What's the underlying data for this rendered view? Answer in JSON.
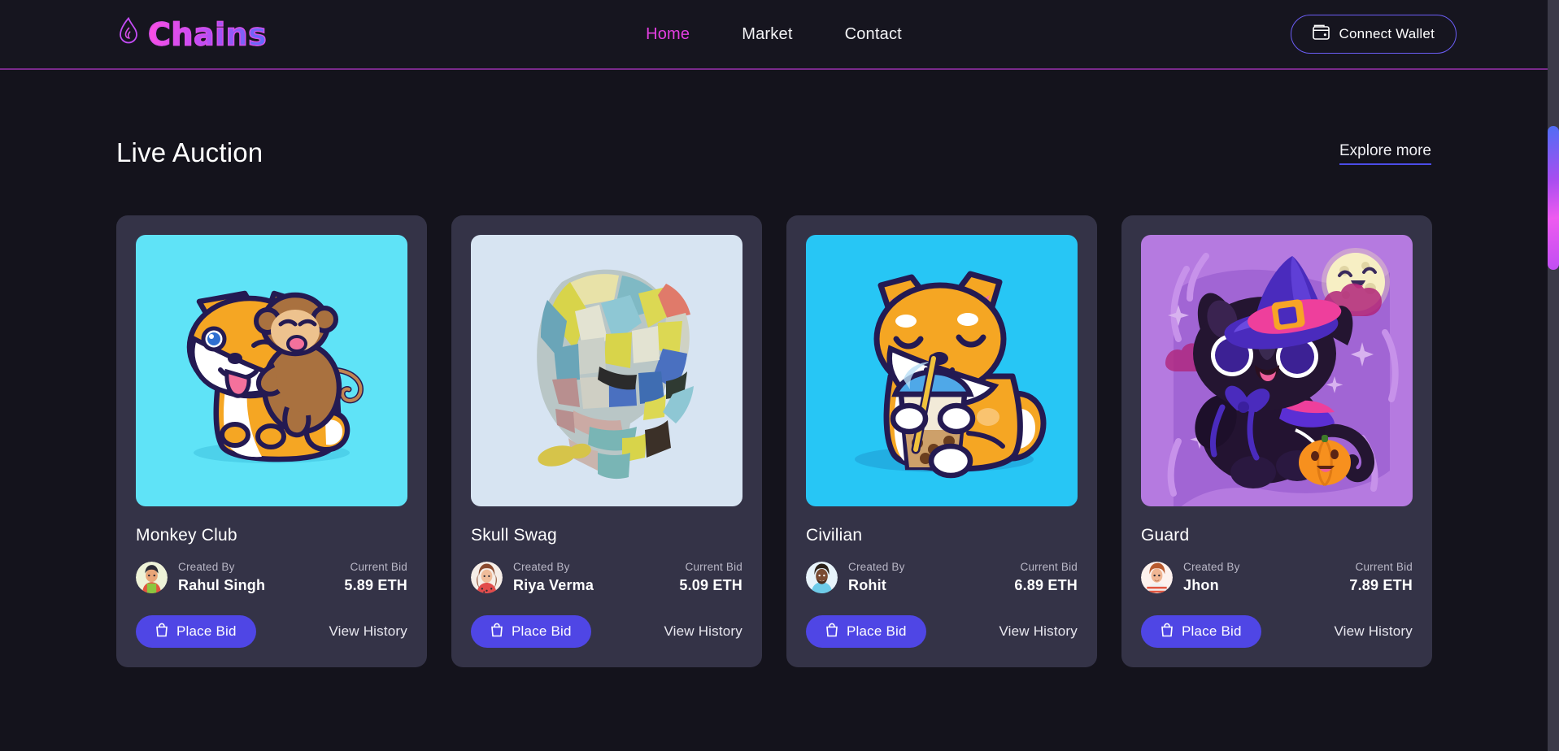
{
  "header": {
    "brand": {
      "name": "Chains",
      "icon": "flame-icon"
    },
    "nav": [
      {
        "label": "Home",
        "active": true
      },
      {
        "label": "Market",
        "active": false
      },
      {
        "label": "Contact",
        "active": false
      }
    ],
    "wallet_button": {
      "label": "Connect Wallet",
      "icon": "wallet-icon"
    },
    "accent_color": "#e23ee0",
    "border_color": "#7a2a8c"
  },
  "section": {
    "title": "Live Auction",
    "explore_link": "Explore more"
  },
  "labels": {
    "created_by": "Created By",
    "current_bid": "Current Bid",
    "place_bid": "Place Bid",
    "view_history": "View History",
    "bid_icon": "shopping-bag-icon"
  },
  "cards": [
    {
      "title": "Monkey Club",
      "creator": "Rahul Singh",
      "bid": "5.89 ETH",
      "artwork": "shiba-with-monkey",
      "artwork_bg": "#5fe3f7"
    },
    {
      "title": "Skull Swag",
      "creator": "Riya Verma",
      "bid": "5.09 ETH",
      "artwork": "painted-skull",
      "artwork_bg": "#d7e4f2"
    },
    {
      "title": "Civilian",
      "creator": "Rohit",
      "bid": "6.89 ETH",
      "artwork": "shiba-boba-tea",
      "artwork_bg": "#27c6f5"
    },
    {
      "title": "Guard",
      "creator": "Jhon",
      "bid": "7.89 ETH",
      "artwork": "witch-cat",
      "artwork_bg": "#b57ae0"
    }
  ],
  "theme": {
    "page_bg": "#14131c",
    "card_bg": "#343347",
    "primary_button": "#4f46e5",
    "underline": "#4b4ce8"
  },
  "scrollbar": {
    "track_color": "#3b3a48",
    "thumb_gradient_from": "#4f6ef5",
    "thumb_gradient_to": "#ee5bf0"
  }
}
